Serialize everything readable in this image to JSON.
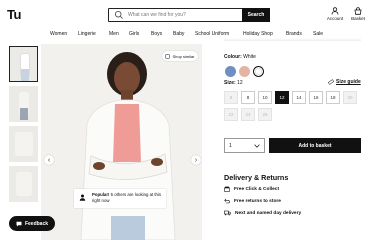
{
  "header": {
    "logo": "Tu",
    "search_placeholder": "What can we find for you?",
    "search_button": "Search",
    "account_label": "Account",
    "basket_label": "Basket"
  },
  "nav": [
    "Women",
    "Lingerie",
    "Men",
    "Girls",
    "Boys",
    "Baby",
    "School Uniform",
    "Holiday Shop",
    "Brands",
    "Sale"
  ],
  "gallery": {
    "shop_similar": "Shop similar",
    "popular_bold": "Popular!",
    "popular_text": "5 others are looking at this right now",
    "prev_icon": "chevron-left-icon",
    "next_icon": "chevron-right-icon"
  },
  "feedback": "Feedback",
  "product": {
    "colour_label": "Colour:",
    "colour_value": "White",
    "swatches": [
      "#6e8fbf",
      "#e3b4a4",
      "#ffffff"
    ],
    "size_label": "Size:",
    "size_value": "12",
    "size_guide": "Size guide",
    "sizes": [
      "6",
      "8",
      "10",
      "12",
      "14",
      "16",
      "18",
      "20",
      "22",
      "24",
      "26"
    ],
    "size_states": [
      "disabled",
      "available",
      "available",
      "selected",
      "available",
      "available",
      "available",
      "disabled",
      "disabled",
      "disabled",
      "disabled"
    ],
    "quantity": "1",
    "add_to_basket": "Add to basket"
  },
  "delivery": {
    "title": "Delivery & Returns",
    "items": [
      "Free Click & Collect",
      "Free returns to store",
      "Next and named day delivery"
    ]
  }
}
